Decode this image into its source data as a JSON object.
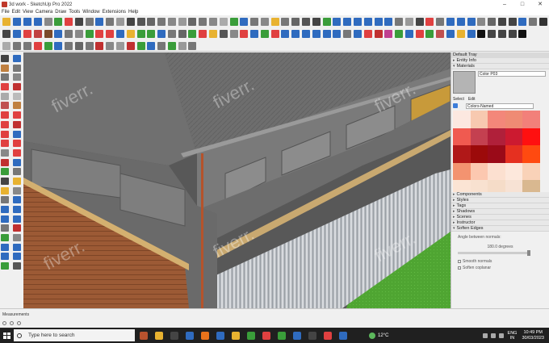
{
  "window": {
    "title": "3d work - SketchUp Pro 2022",
    "controls": [
      "–",
      "□",
      "✕"
    ]
  },
  "menu": [
    "File",
    "Edit",
    "View",
    "Camera",
    "Draw",
    "Tools",
    "Window",
    "Extensions",
    "Help"
  ],
  "toolbars": {
    "row1_colors": [
      "#e8b230",
      "#2f6bbf",
      "#2f6bbf",
      "#2f6bbf",
      "#888",
      "#3a9d3a",
      "#e04040",
      "#444",
      "#777",
      "#2f6bbf",
      "#777",
      "#999",
      "#444",
      "#555",
      "#666",
      "#777",
      "#888",
      "#999",
      "#666",
      "#777",
      "#888",
      "#aaa",
      "#3a9d3a",
      "#2f6bbf",
      "#777",
      "#888",
      "#e8b230",
      "#777",
      "#666",
      "#555",
      "#444",
      "#3a9d3a",
      "#2f6bbf",
      "#2f6bbf",
      "#2f6bbf",
      "#2f6bbf",
      "#2f6bbf",
      "#2f6bbf",
      "#777",
      "#999",
      "#444",
      "#e04040",
      "#777",
      "#2f6bbf",
      "#2f6bbf",
      "#2f6bbf",
      "#888",
      "#666",
      "#444",
      "#444",
      "#2f6bbf",
      "#777",
      "#333"
    ],
    "row2_colors": [
      "#444",
      "#2f6bbf",
      "#e04040",
      "#c04040",
      "#7a4a2a",
      "#2f6bbf",
      "#777",
      "#888",
      "#3a9d3a",
      "#e04040",
      "#e04040",
      "#2f6bbf",
      "#e8b230",
      "#3a9d3a",
      "#3a9d3a",
      "#2f6bbf",
      "#777",
      "#666",
      "#3a9d3a",
      "#e04040",
      "#e8b230",
      "#555",
      "#888",
      "#e04040",
      "#2f6bbf",
      "#3a9d3a",
      "#e04040",
      "#2f6bbf",
      "#2f6bbf",
      "#2f6bbf",
      "#2f6bbf",
      "#2f6bbf",
      "#2f6bbf",
      "#777",
      "#2f6bbf",
      "#e04040",
      "#c03030",
      "#c04090",
      "#3a9d3a",
      "#2f6bbf",
      "#e04040",
      "#3a9d3a",
      "#c05050",
      "#2f6bbf",
      "#e8b230",
      "#2f6bbf",
      "#111",
      "#444",
      "#444",
      "#444",
      "#111"
    ],
    "row3_colors": [
      "#aaa",
      "#777",
      "#777",
      "#e04040",
      "#3a9d3a",
      "#2f6bbf",
      "#777",
      "#666",
      "#777",
      "#c03030",
      "#888",
      "#999",
      "#c03030",
      "#3a9d3a",
      "#2f6bbf",
      "#777",
      "#3a9d3a",
      "#999",
      "#777"
    ]
  },
  "left_tools_colors": [
    "#444",
    "#2f6bbf",
    "#c08040",
    "#777",
    "#777",
    "#888",
    "#e04040",
    "#c03030",
    "#aaa",
    "#bbb",
    "#c05050",
    "#c08040",
    "#e04040",
    "#e04040",
    "#e04040",
    "#c03030",
    "#e04040",
    "#2f6bbf",
    "#e04040",
    "#e04040",
    "#888",
    "#e04040",
    "#c03030",
    "#2f6bbf",
    "#3a9d3a",
    "#777",
    "#444",
    "#e8b230",
    "#e8b230",
    "#888",
    "#777",
    "#2f6bbf",
    "#2f6bbf",
    "#2f6bbf",
    "#2f6bbf",
    "#2f6bbf",
    "#777",
    "#c03030",
    "#3a9d3a",
    "#888",
    "#2f6bbf",
    "#2f6bbf",
    "#2f6bbf",
    "#2f6bbf",
    "#3a9d3a",
    "#555"
  ],
  "tray": {
    "title": "Default Tray",
    "entity_info": "Entity Info",
    "materials": "Materials",
    "material_name": "Color P03",
    "select_tab": "Select",
    "edit_tab": "Edit",
    "library": "Colors-Named",
    "palette": [
      "#fce8e0",
      "#f7c9b0",
      "#f3877a",
      "#ef8b74",
      "#f2807a",
      "#f05a50",
      "#c44050",
      "#b0203a",
      "#cc1a30",
      "#ff1010",
      "#b01818",
      "#9c0a0a",
      "#9a0a18",
      "#e53020",
      "#ff4a10",
      "#f39370",
      "#fcc8b0",
      "#fce0d0",
      "#fde8dc",
      "#f9d2b8",
      "#fbe4d4",
      "#f8e1d0",
      "#f5dcc8",
      "#f7e2d4",
      "#d9b890"
    ],
    "panels": [
      "Components",
      "Styles",
      "Tags",
      "Shadows",
      "Scenes",
      "Instructor",
      "Soften Edges"
    ],
    "soften": {
      "angle_label": "Angle between normals:",
      "angle_value": "180.0",
      "angle_unit": "degrees",
      "smooth_normals": "Smooth normals",
      "soften_coplanar": "Soften coplanar"
    }
  },
  "scene": {
    "watermark": "fiverr."
  },
  "status": {
    "measurements": "Measurements"
  },
  "taskbar": {
    "search_placeholder": "Type here to search",
    "apps": [
      "#b7522e",
      "#e8b230",
      "#444",
      "#2f6bbf",
      "#e8731b",
      "#2f6bbf",
      "#e8b230",
      "#3a9d3a",
      "#e04040",
      "#3a9d3a",
      "#2f6bbf",
      "#444",
      "#e04040",
      "#2f6bbf"
    ],
    "weather": "12°C",
    "lang_top": "ENG",
    "lang_bottom": "IN",
    "time": "10:49 PM",
    "date": "30/03/2023"
  }
}
